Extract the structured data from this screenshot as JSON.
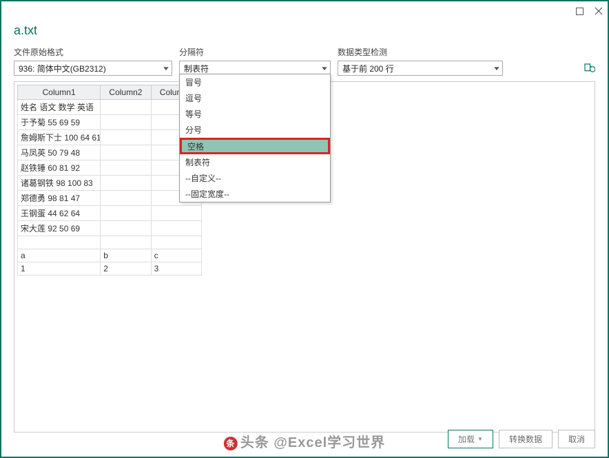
{
  "filename": "a.txt",
  "controls": {
    "fileOrigin": {
      "label": "文件原始格式",
      "value": "936: 简体中文(GB2312)"
    },
    "delimiter": {
      "label": "分隔符",
      "value": "制表符"
    },
    "dataTypeDetect": {
      "label": "数据类型检测",
      "value": "基于前 200 行"
    }
  },
  "delimiterMenu": {
    "items": [
      "冒号",
      "逗号",
      "等号",
      "分号",
      "空格",
      "制表符",
      "--自定义--",
      "--固定宽度--"
    ],
    "highlighted": "空格"
  },
  "preview": {
    "headers": [
      "Column1",
      "Column2",
      "Column3"
    ],
    "rows": [
      [
        "姓名 语文 数学 英语",
        "",
        ""
      ],
      [
        "于予菊 55 69 59",
        "",
        ""
      ],
      [
        "詹姆斯下士 100 64 61",
        "",
        ""
      ],
      [
        "马凤英 50 79 48",
        "",
        ""
      ],
      [
        "赵铁锤 60 81 92",
        "",
        ""
      ],
      [
        "诸葛钢铁 98 100 83",
        "",
        ""
      ],
      [
        "郑德勇 98 81 47",
        "",
        ""
      ],
      [
        "王钢蛋 44 62 64",
        "",
        ""
      ],
      [
        "宋大莲 92 50 69",
        "",
        ""
      ]
    ],
    "schemaRows": [
      [
        "a",
        "b",
        "c"
      ],
      [
        "1",
        "2",
        "3"
      ]
    ]
  },
  "buttons": {
    "load": "加载",
    "transform": "转换数据",
    "cancel": "取消"
  },
  "watermark": "头条 @Excel学习世界"
}
